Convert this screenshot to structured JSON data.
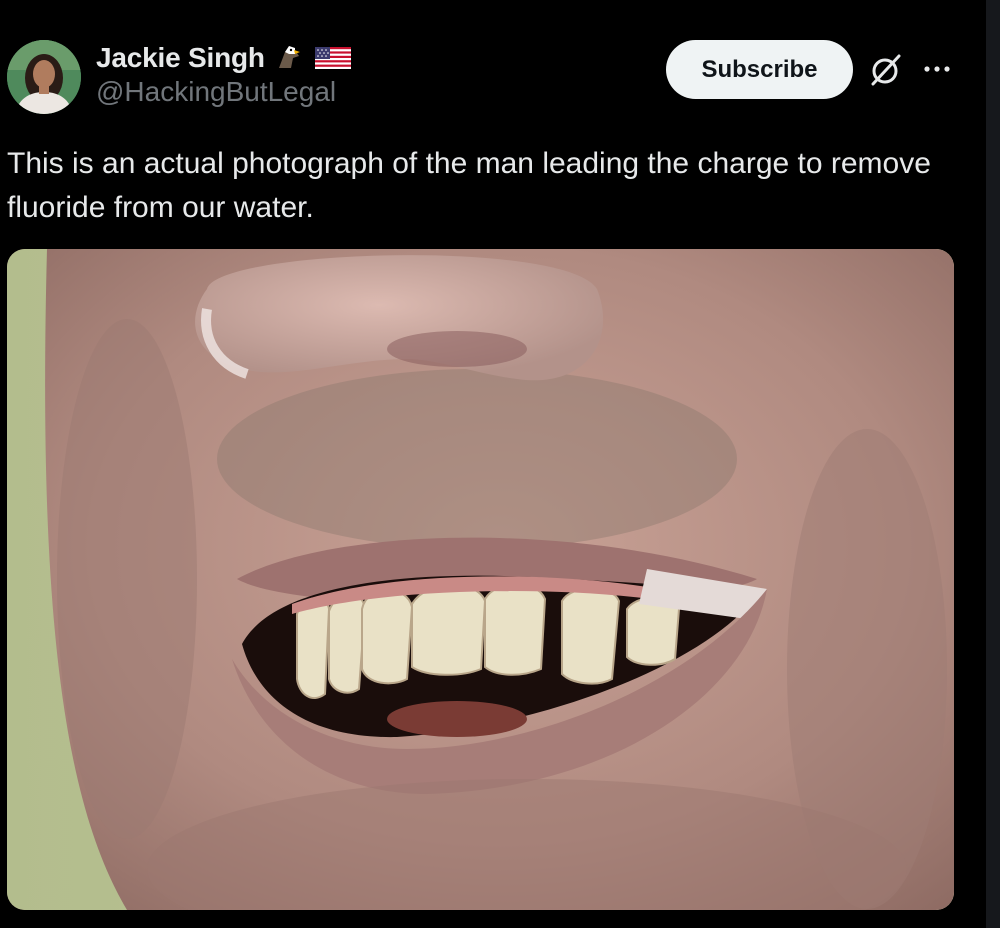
{
  "post": {
    "author": {
      "display_name": "Jackie Singh",
      "handle": "@HackingButLegal",
      "badges": [
        "eagle-icon",
        "us-flag-icon"
      ]
    },
    "actions": {
      "subscribe_label": "Subscribe",
      "grok_icon": "grok-icon",
      "more_icon": "more-icon"
    },
    "text": "This is an actual photograph of the man leading the charge to remove fluoride from our water."
  },
  "colors": {
    "background": "#000000",
    "text_primary": "#e7e9ea",
    "text_secondary": "#71767b",
    "button_bg": "#eff3f4",
    "button_text": "#0f1419"
  }
}
